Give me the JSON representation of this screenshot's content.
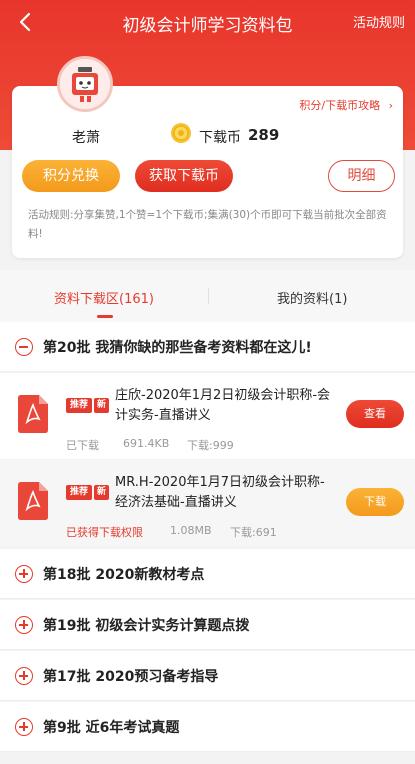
{
  "header": {
    "title": "初级会计师学习资料包",
    "rule_link": "活动规则"
  },
  "profile": {
    "points_link": "积分/下载币攻略",
    "username": "老萧",
    "coin_label": "下载币",
    "coin_value": "289"
  },
  "actions": {
    "exchange": "积分兑换",
    "get_coins": "获取下载币",
    "detail": "明细"
  },
  "rules_text": "活动规则:分享集赞,1个赞=1个下载币;集满(30)个币即可下载当前批次全部资料!",
  "tabs": [
    {
      "label": "资料下载区(161)"
    },
    {
      "label": "我的资料(1)"
    }
  ],
  "batches": [
    {
      "title": "第20批 我猜你缺的那些备考资料都在这儿!"
    },
    {
      "title": "第18批 2020新教材考点"
    },
    {
      "title": "第19批 初级会计实务计算题点拨"
    },
    {
      "title": "第17批 2020预习备考指导"
    },
    {
      "title": "第9批 近6年考试真题"
    }
  ],
  "files": [
    {
      "tag_rec": "推荐",
      "tag_new": "新",
      "name": "庄欣-2020年1月2日初级会计职称-会计实务-直播讲义",
      "status": "已下载",
      "size": "691.4KB",
      "downloads": "下载:999",
      "action": "查看"
    },
    {
      "tag_rec": "推荐",
      "tag_new": "新",
      "name": "MR.H-2020年1月7日初级会计职称-经济法基础-直播讲义",
      "status": "已获得下载权限",
      "size": "1.08MB",
      "downloads": "下载:691",
      "action": "下载"
    }
  ],
  "colors": {
    "brand_red": "#e53b2f",
    "orange": "#f6a424"
  }
}
